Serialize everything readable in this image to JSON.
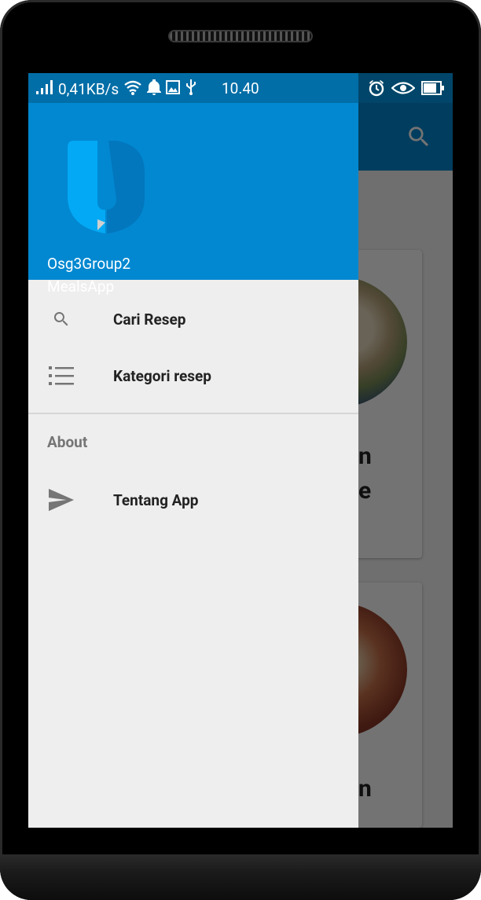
{
  "status_bar": {
    "network_speed": "0,41KB/s",
    "time": "10.40",
    "icons": [
      "signal-icon",
      "wifi-icon",
      "bell-icon",
      "image-icon",
      "usb-icon",
      "alarm-icon",
      "eye-icon",
      "battery-icon"
    ]
  },
  "drawer": {
    "header": {
      "title_line1": "Osg3Group2",
      "title_line2": "MealsApp"
    },
    "items": [
      {
        "label": "Cari Resep",
        "icon": "search-icon"
      },
      {
        "label": "Kategori resep",
        "icon": "list-icon"
      }
    ],
    "section": {
      "title": "About",
      "items": [
        {
          "label": "Tentang App",
          "icon": "send-icon"
        }
      ]
    }
  },
  "background": {
    "card1_text_a": "n",
    "card1_text_b": "e",
    "card2_text": "n"
  },
  "colors": {
    "primary": "#0288d1",
    "drawer_bg": "#eeeeee"
  }
}
